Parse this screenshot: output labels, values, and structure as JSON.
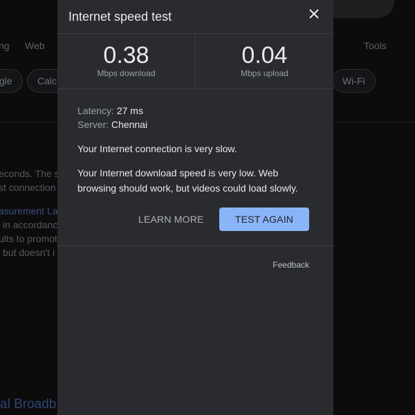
{
  "background": {
    "tabs": [
      "ng",
      "Web",
      "Tools"
    ],
    "chips": [
      "gle",
      "Calc",
      "Wi-Fi"
    ],
    "snippets": [
      "econds. The sp",
      "st connection",
      "asurement La",
      "in accordanc",
      "ults to promot",
      "but doesn't i"
    ],
    "bottom_link": "al Broadb"
  },
  "dialog": {
    "title": "Internet speed test",
    "download": {
      "value": "0.38",
      "label": "Mbps download"
    },
    "upload": {
      "value": "0.04",
      "label": "Mbps upload"
    },
    "latency": {
      "label": "Latency:",
      "value": "27 ms"
    },
    "server": {
      "label": "Server:",
      "value": "Chennai"
    },
    "message1": "Your Internet connection is very slow.",
    "message2": "Your Internet download speed is very low. Web browsing should work, but videos could load slowly.",
    "learn_more": "LEARN MORE",
    "test_again": "TEST AGAIN",
    "feedback": "Feedback"
  },
  "colors": {
    "accent": "#8ab4f8",
    "dialog_bg": "#2a2b2e",
    "page_bg": "#0c0c0d"
  },
  "icons": [
    "close-icon",
    "search-icon",
    "google-lens-icon"
  ]
}
